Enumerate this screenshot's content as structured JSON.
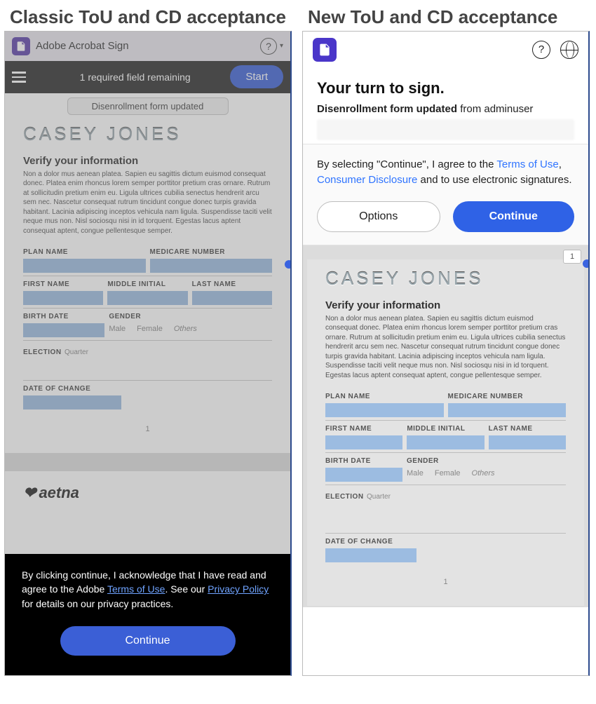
{
  "headings": {
    "classic": "Classic ToU and CD acceptance",
    "new": "New ToU and CD acceptance"
  },
  "classic": {
    "app_name": "Adobe Acrobat Sign",
    "fields_remaining": "1 required field remaining",
    "start": "Start",
    "chip": "Disenrollment form updated",
    "footer_text_pre": "By clicking continue, I acknowledge that I have read and agree to the Adobe ",
    "tou": "Terms of Use",
    "footer_text_mid": ". See our ",
    "privacy": "Privacy Policy",
    "footer_text_post": " for details on our privacy practices.",
    "continue": "Continue"
  },
  "new": {
    "title": "Your turn to sign.",
    "doc_name": "Disenrollment form updated",
    "from_label": " from ",
    "from_user": "adminuser",
    "ellipsis": "…",
    "consent_pre": "By selecting \"Continue\", I agree to the ",
    "tou": "Terms of Use",
    "consent_mid": ", ",
    "cd": "Consumer Disclosure",
    "consent_post": " and to use electronic signatures.",
    "options": "Options",
    "continue": "Continue",
    "page_indicator": "1"
  },
  "doc": {
    "casey": "CASEY JONES",
    "verify": "Verify your information",
    "lorem": "Non a dolor mus aenean platea. Sapien eu sagittis dictum euismod consequat donec. Platea enim rhoncus lorem semper porttitor pretium cras ornare. Rutrum at sollicitudin pretium enim eu. Ligula ultrices cubilia senectus hendrerit arcu sem nec. Nascetur consequat rutrum tincidunt congue donec turpis gravida habitant. Lacinia adipiscing inceptos vehicula nam ligula. Suspendisse taciti velit neque mus non. Nisl sociosqu nisi in id torquent. Egestas lacus aptent consequat aptent, congue pellentesque semper.",
    "labels": {
      "plan_name": "PLAN NAME",
      "medicare_number": "MEDICARE NUMBER",
      "first_name": "FIRST NAME",
      "middle_initial": "MIDDLE INITIAL",
      "last_name": "LAST NAME",
      "birth_date": "BIRTH DATE",
      "gender": "GENDER",
      "election": "ELECTION",
      "date_of_change": "DATE OF CHANGE"
    },
    "gender_options": {
      "male": "Male",
      "female": "Female",
      "others": "Others"
    },
    "election_value": "Quarter",
    "aetna": "aetna",
    "page_num": "1"
  }
}
